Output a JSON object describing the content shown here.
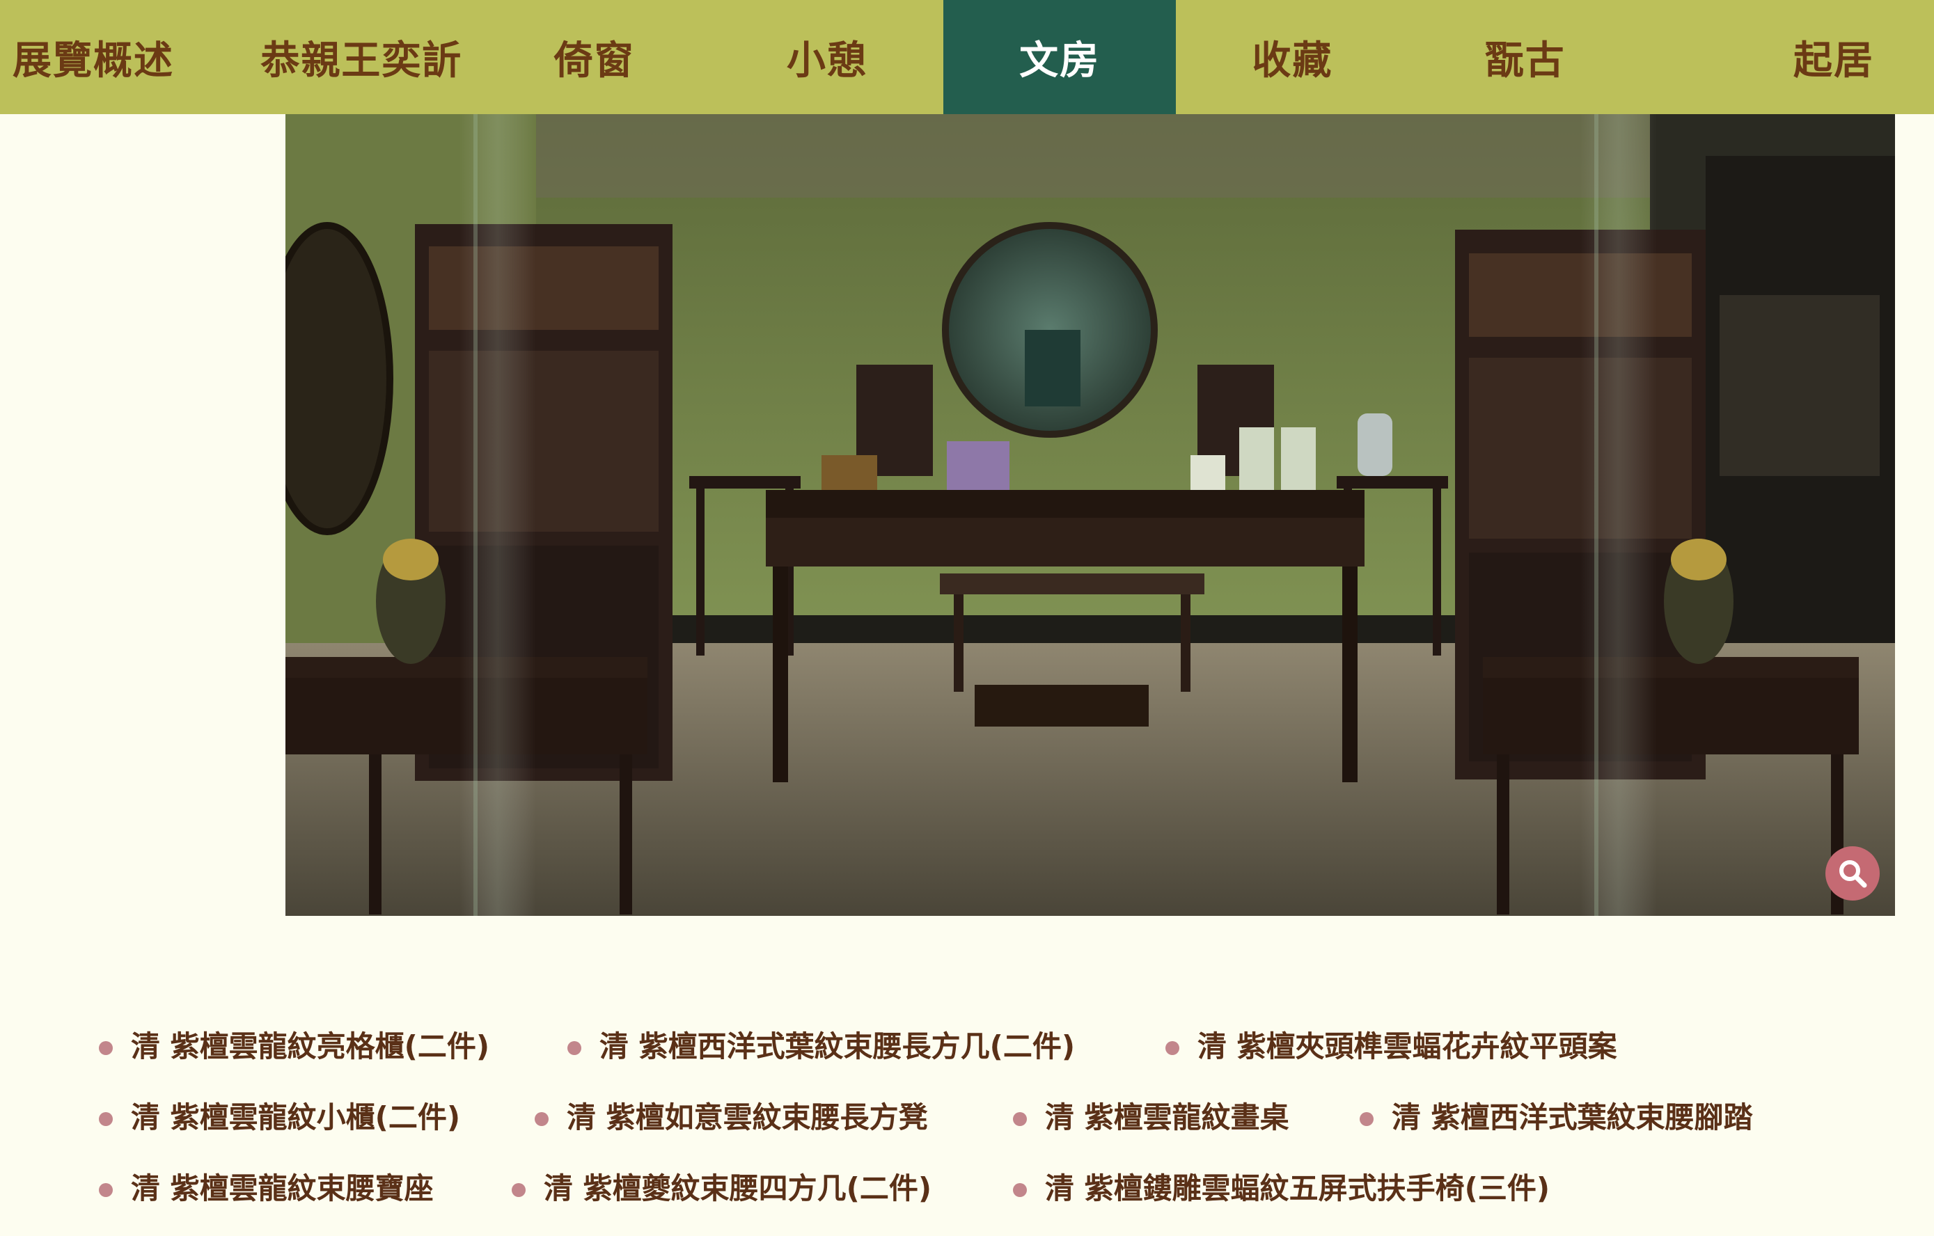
{
  "nav": {
    "items": [
      {
        "label": "展覽概述"
      },
      {
        "label": "恭親王奕訢"
      },
      {
        "label": "倚窗"
      },
      {
        "label": "小憩"
      },
      {
        "label": "文房"
      },
      {
        "label": "收藏"
      },
      {
        "label": "翫古"
      },
      {
        "label": "起居"
      }
    ],
    "active_index": 4
  },
  "photo": {
    "zoom_icon": "search-icon"
  },
  "items": [
    {
      "label": "清 紫檀雲龍紋亮格櫃(二件)"
    },
    {
      "label": "清 紫檀西洋式葉紋束腰長方几(二件)"
    },
    {
      "label": "清 紫檀夾頭榫雲蝠花卉紋平頭案"
    },
    {
      "label": "清 紫檀雲龍紋小櫃(二件)"
    },
    {
      "label": "清 紫檀如意雲紋束腰長方凳"
    },
    {
      "label": "清 紫檀雲龍紋畫桌"
    },
    {
      "label": "清 紫檀西洋式葉紋束腰腳踏"
    },
    {
      "label": "清 紫檀雲龍紋束腰寶座"
    },
    {
      "label": "清 紫檀夔紋束腰四方几(二件)"
    },
    {
      "label": "清 紫檀鏤雕雲蝠紋五屏式扶手椅(三件)"
    }
  ],
  "colors": {
    "nav_bg": "#bcc05a",
    "nav_active_bg": "#235e4e",
    "nav_text": "#6b3a14",
    "page_bg": "#fdfdf0",
    "bullet": "#c2868b",
    "zoom_button": "#c56a73"
  }
}
